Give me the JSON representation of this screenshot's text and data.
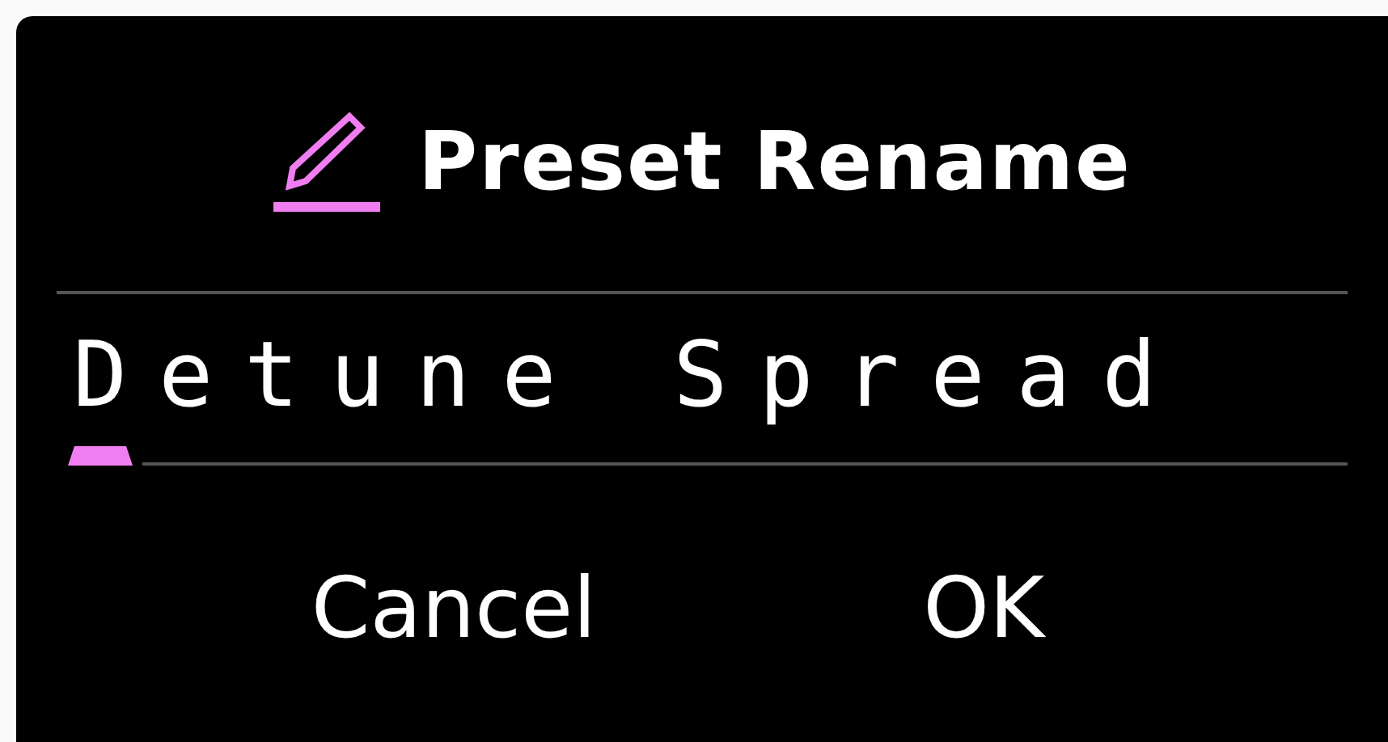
{
  "dialog": {
    "title": "Preset Rename"
  },
  "name_field": {
    "value": "Detune Spread"
  },
  "buttons": [
    {
      "label": "Cancel"
    },
    {
      "label": "OK"
    }
  ]
}
